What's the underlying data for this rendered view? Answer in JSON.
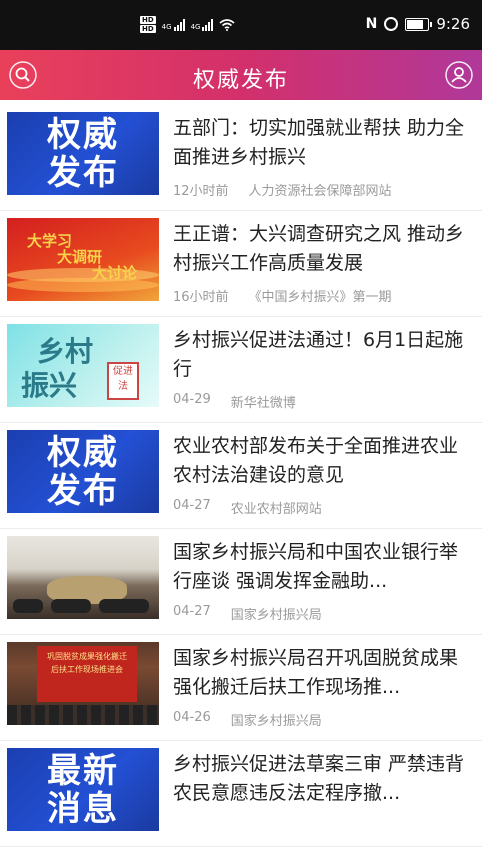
{
  "status_bar": {
    "hd1": "HD",
    "hd2": "HD",
    "net1": "4G",
    "net2": "4G",
    "time": "9:26",
    "battery_level": 0.7
  },
  "header": {
    "title": "权威发布",
    "left_icon": "search-icon",
    "right_icon": "user-icon"
  },
  "articles": [
    {
      "title": "五部门：切实加强就业帮扶 助力全面推进乡村振兴",
      "time": "12小时前",
      "source": "人力资源社会保障部网站",
      "thumb_text": [
        "权威",
        "发布"
      ]
    },
    {
      "title": "王正谱：大兴调查研究之风 推动乡村振兴工作高质量发展",
      "time": "16小时前",
      "source": "《中国乡村振兴》第一期",
      "thumb_text": [
        "大学习",
        "大调研",
        "大讨论"
      ]
    },
    {
      "title": "乡村振兴促进法通过！6月1日起施行",
      "time": "04-29",
      "source": "新华社微博",
      "thumb_text": [
        "乡村",
        "振兴",
        "促进法"
      ]
    },
    {
      "title": "农业农村部发布关于全面推进农业农村法治建设的意见",
      "time": "04-27",
      "source": "农业农村部网站",
      "thumb_text": [
        "权威",
        "发布"
      ]
    },
    {
      "title": "国家乡村振兴局和中国农业银行举行座谈 强调发挥金融助...",
      "time": "04-27",
      "source": "国家乡村振兴局"
    },
    {
      "title": "国家乡村振兴局召开巩固脱贫成果强化搬迁后扶工作现场推...",
      "time": "04-26",
      "source": "国家乡村振兴局",
      "thumb_text": [
        "巩固脱贫成果强化搬迁",
        "后扶工作现场推进会"
      ]
    },
    {
      "title": "乡村振兴促进法草案三审 严禁违背农民意愿违反法定程序撤...",
      "time": "",
      "source": "",
      "thumb_text": [
        "最新",
        "消息"
      ]
    }
  ]
}
